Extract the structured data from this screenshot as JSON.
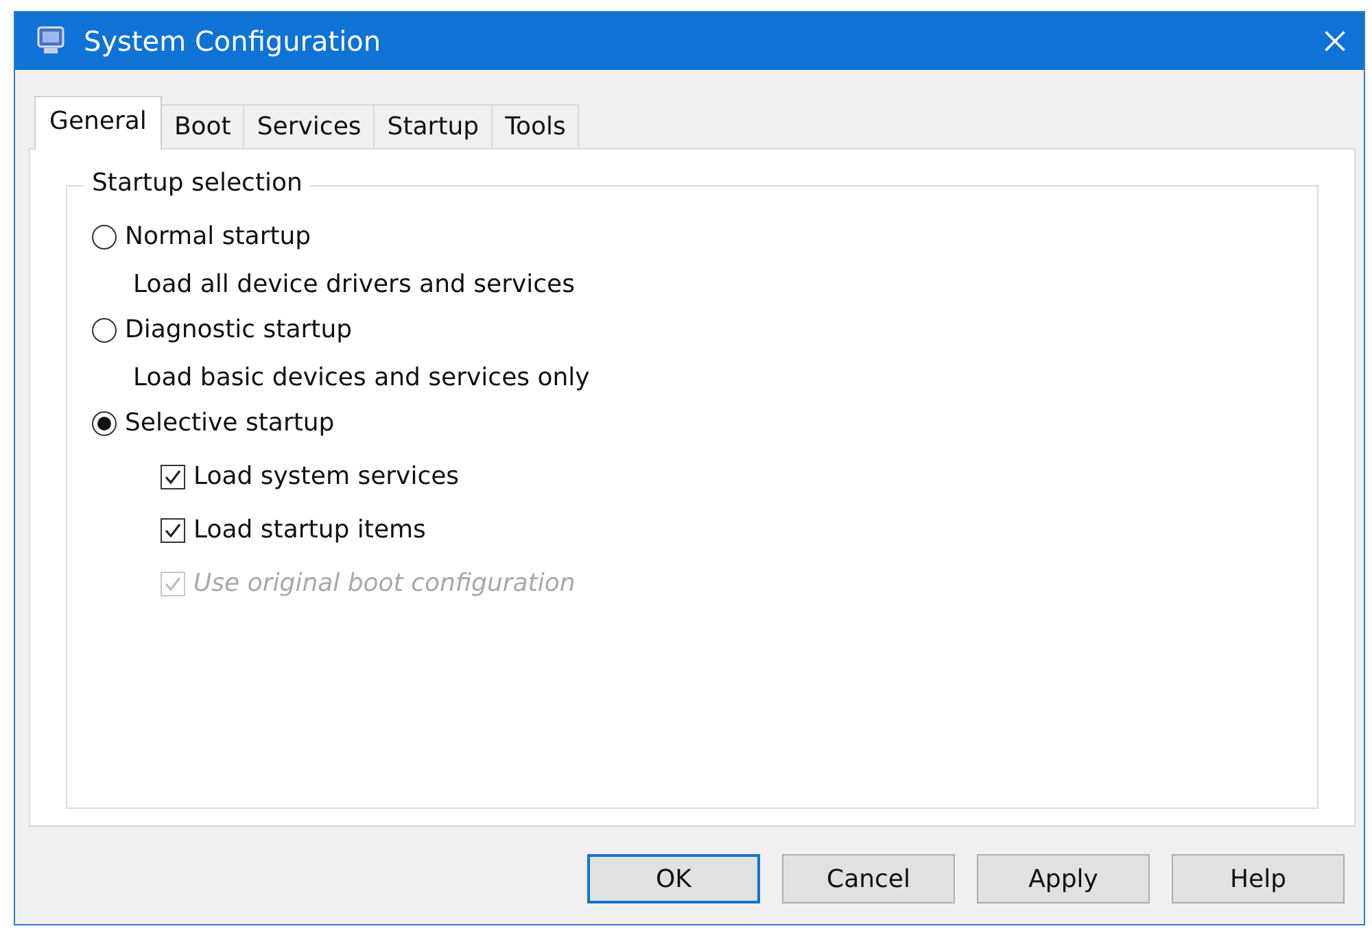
{
  "window": {
    "title": "System Configuration"
  },
  "tabs": [
    {
      "label": "General",
      "selected": true
    },
    {
      "label": "Boot",
      "selected": false
    },
    {
      "label": "Services",
      "selected": false
    },
    {
      "label": "Startup",
      "selected": false
    },
    {
      "label": "Tools",
      "selected": false
    }
  ],
  "group": {
    "title": "Startup selection",
    "options": [
      {
        "kind": "radio",
        "label": "Normal startup",
        "selected": false,
        "description": "Load all device drivers and services"
      },
      {
        "kind": "radio",
        "label": "Diagnostic startup",
        "selected": false,
        "description": "Load basic devices and services only"
      },
      {
        "kind": "radio",
        "label": "Selective startup",
        "selected": true
      },
      {
        "kind": "checkbox",
        "label": "Load system services",
        "checked": true,
        "disabled": false
      },
      {
        "kind": "checkbox",
        "label": "Load startup items",
        "checked": true,
        "disabled": false
      },
      {
        "kind": "checkbox",
        "label": "Use original boot configuration",
        "checked": true,
        "disabled": true
      }
    ]
  },
  "buttons": [
    {
      "label": "OK",
      "focused": true
    },
    {
      "label": "Cancel",
      "focused": false
    },
    {
      "label": "Apply",
      "focused": false
    },
    {
      "label": "Help",
      "focused": false
    }
  ]
}
